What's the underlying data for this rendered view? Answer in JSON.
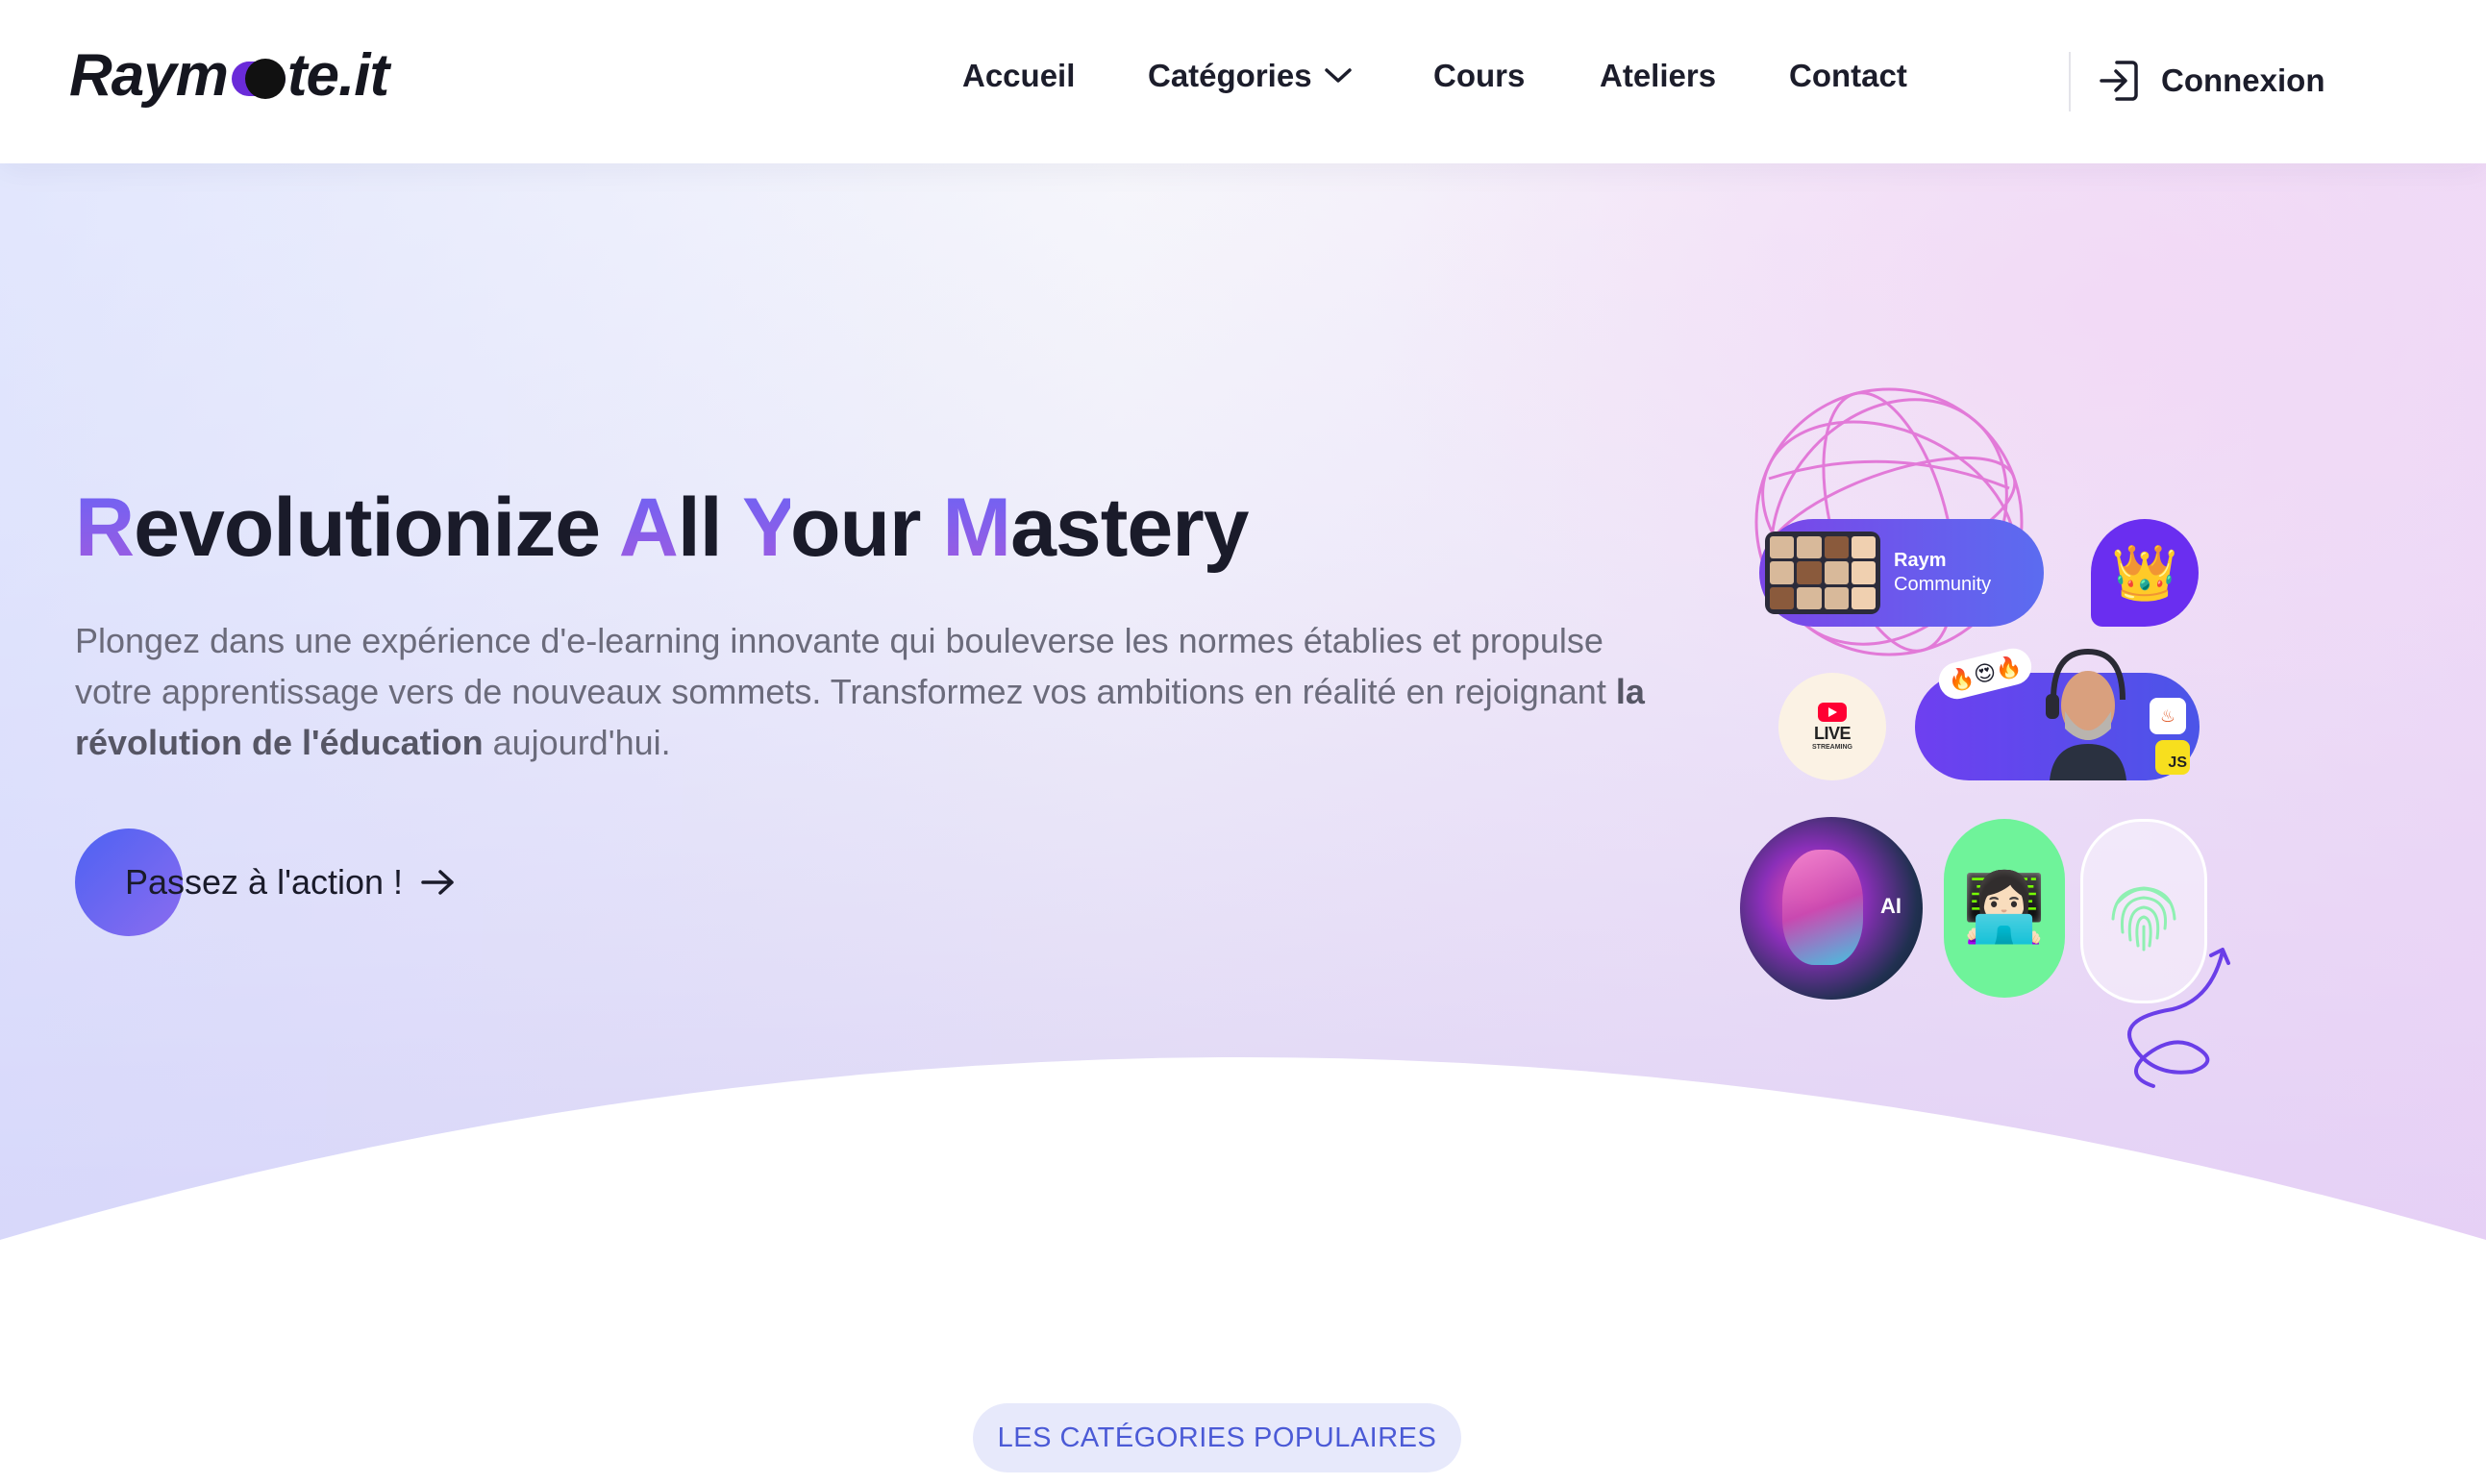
{
  "header": {
    "logo_left": "Raym",
    "logo_right": "te.it",
    "nav": [
      {
        "label": "Accueil"
      },
      {
        "label": "Catégories",
        "icon": "chevron-down-icon"
      },
      {
        "label": "Cours"
      },
      {
        "label": "Ateliers"
      },
      {
        "label": "Contact"
      }
    ],
    "login": {
      "label": "Connexion",
      "icon": "login-icon"
    }
  },
  "hero": {
    "headline": [
      {
        "accent": "R",
        "rest": "evolutionize "
      },
      {
        "accent": "A",
        "rest": "ll "
      },
      {
        "accent": "Y",
        "rest": "our "
      },
      {
        "accent": "M",
        "rest": "astery"
      }
    ],
    "subtext_before": "Plongez dans une expérience d'e-learning innovante qui bouleverse les normes établies et propulse votre apprentissage vers de nouveaux sommets. Transformez vos ambitions en réalité en rejoignant ",
    "subtext_bold": "la révolution de l'éducation",
    "subtext_after": " aujourd'hui.",
    "cta_label": "Passez à l'action !",
    "cta_icon": "arrow-right-icon"
  },
  "illustration": {
    "community_title": "Raym",
    "community_subtitle": "Community",
    "crown_icon": "👑",
    "live_label": "LIVE",
    "live_sublabel": "STREAMING",
    "emoji_chat": "🔥😍🔥",
    "java_badge": "♨",
    "js_badge": "JS",
    "ai_label": "AI",
    "developer_icon": "👩🏻‍💻",
    "fingerprint_icon": "fingerprint-icon",
    "accent_colors": [
      "#6b63f5",
      "#a05be0",
      "#6a2ef0",
      "#6ff39a"
    ]
  },
  "section": {
    "badge": "LES CATÉGORIES POPULAIRES"
  }
}
